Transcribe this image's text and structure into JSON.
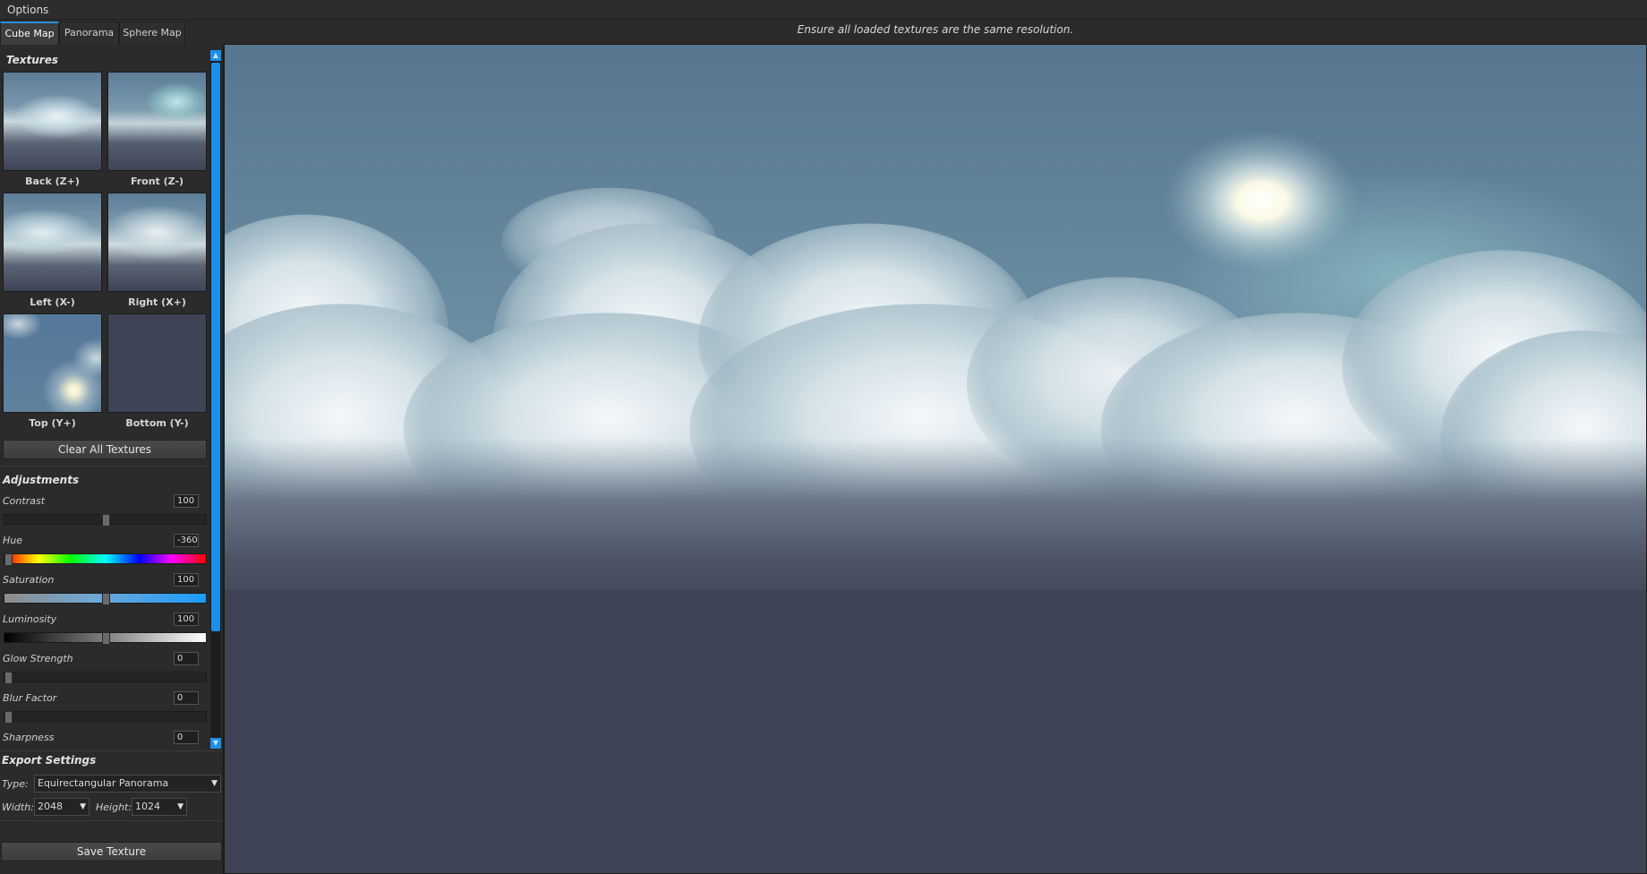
{
  "menu": {
    "options_label": "Options"
  },
  "tabs": [
    {
      "label": "Cube Map",
      "active": true
    },
    {
      "label": "Panorama",
      "active": false
    },
    {
      "label": "Sphere Map",
      "active": false
    }
  ],
  "notice": "Ensure all loaded textures are the same resolution.",
  "textures": {
    "title": "Textures",
    "faces": [
      {
        "label": "Back (Z+)"
      },
      {
        "label": "Front (Z-)"
      },
      {
        "label": "Left (X-)"
      },
      {
        "label": "Right (X+)"
      },
      {
        "label": "Top (Y+)"
      },
      {
        "label": "Bottom (Y-)"
      }
    ],
    "clear_label": "Clear All Textures"
  },
  "adjustments": {
    "title": "Adjustments",
    "contrast": {
      "label": "Contrast",
      "value": "100",
      "level": 0.5
    },
    "hue": {
      "label": "Hue",
      "value": "-360",
      "level": 0.0
    },
    "saturation": {
      "label": "Saturation",
      "value": "100",
      "level": 0.5
    },
    "luminosity": {
      "label": "Luminosity",
      "value": "100",
      "level": 0.5
    },
    "glow_strength": {
      "label": "Glow Strength",
      "value": "0",
      "level": 0.0
    },
    "blur_factor": {
      "label": "Blur Factor",
      "value": "0",
      "level": 0.0
    },
    "sharpness": {
      "label": "Sharpness",
      "value": "0"
    }
  },
  "export": {
    "title": "Export Settings",
    "type_label": "Type:",
    "type_value": "Equirectangular Panorama",
    "width_label": "Width:",
    "width_value": "2048",
    "height_label": "Height:",
    "height_value": "1024",
    "save_label": "Save Texture"
  },
  "colors": {
    "accent": "#1e8fe6",
    "sky_top": "#5b7c98",
    "ground": "#3e4455"
  }
}
